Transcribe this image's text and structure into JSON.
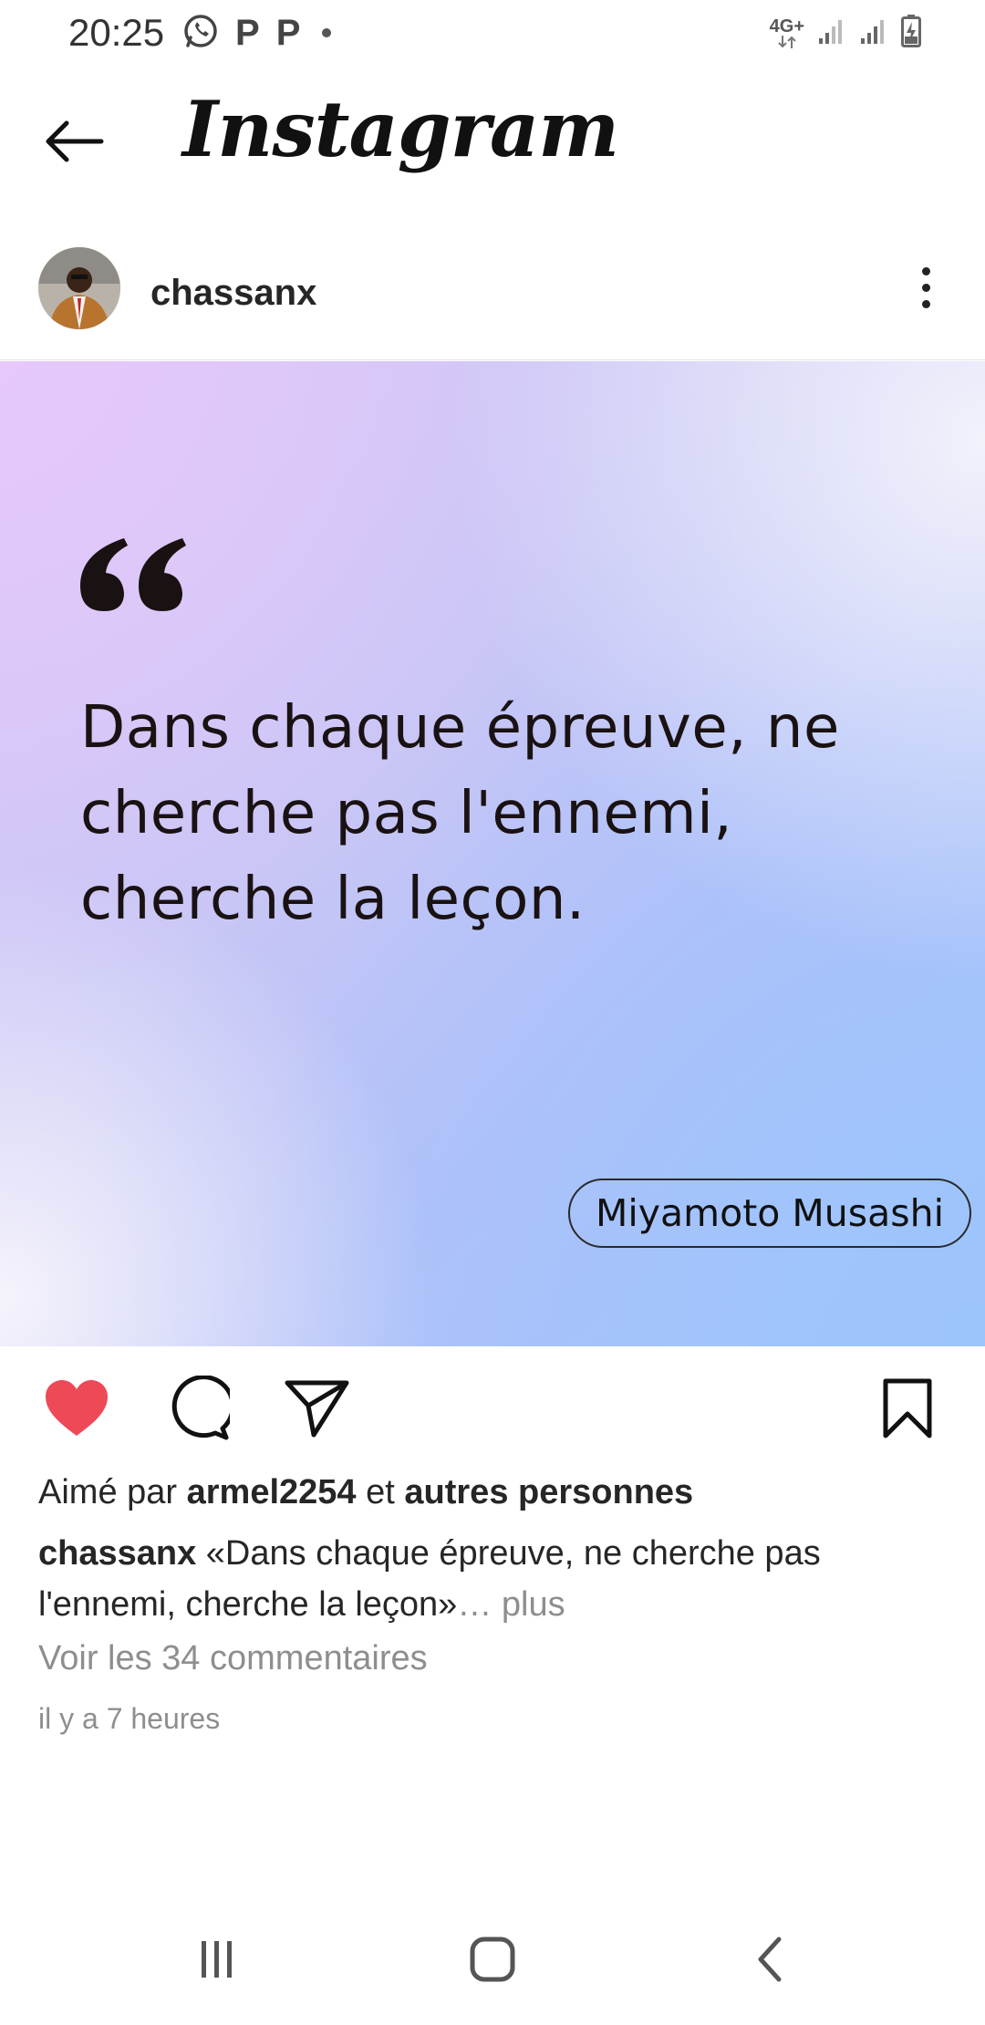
{
  "status_bar": {
    "time": "20:25",
    "left_icons": [
      "whatsapp-icon",
      "p-icon",
      "p-icon",
      "dot-icon"
    ],
    "p_glyph": "P",
    "network": "4G+",
    "right_icons": [
      "network-4g-icon",
      "signal-1-icon",
      "signal-2-icon",
      "battery-charging-icon"
    ]
  },
  "header": {
    "back_icon": "arrow-left-icon",
    "title": "Instagram"
  },
  "post": {
    "username": "chassanx",
    "more_icon": "more-vertical-icon",
    "image": {
      "quote_icon": "quote-icon",
      "quote": "Dans chaque épreuve, ne cherche pas l'ennemi, cherche la leçon.",
      "author": "Miyamoto Musashi"
    },
    "actions": {
      "like_icon": "heart-filled-icon",
      "comment_icon": "comment-icon",
      "share_icon": "send-icon",
      "save_icon": "bookmark-icon",
      "liked": true,
      "like_color": "#ed4956"
    },
    "likes": {
      "prefix": "Aimé par",
      "user": "armel2254",
      "joiner": "et",
      "others": "autres personnes"
    },
    "caption": {
      "username": "chassanx",
      "text": "«Dans chaque épreuve, ne cherche pas l'ennemi, cherche la leçon»",
      "more": "… plus"
    },
    "comments_link": "Voir les 34 commentaires",
    "timestamp": "il y a 7 heures"
  },
  "nav_bar": {
    "recent_icon": "recent-apps-icon",
    "home_icon": "home-icon",
    "back_icon": "nav-back-icon"
  }
}
